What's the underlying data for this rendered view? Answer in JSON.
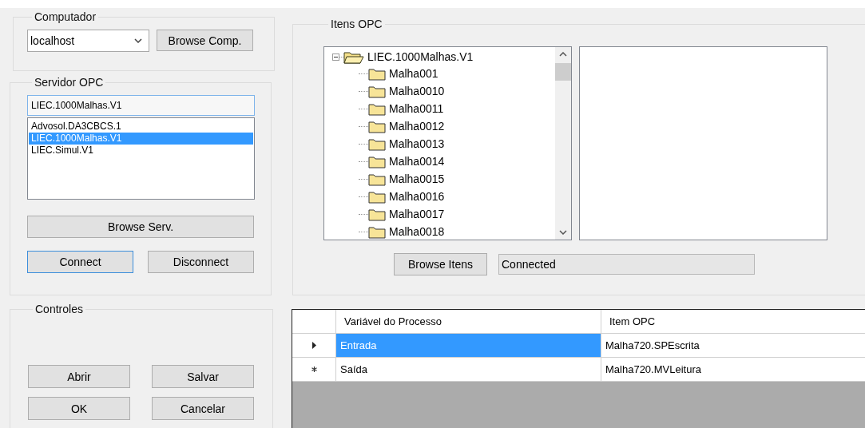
{
  "computer": {
    "title": "Computador",
    "value": "localhost",
    "browse_button": "Browse Comp."
  },
  "server": {
    "title": "Servidor OPC",
    "value": "LIEC.1000Malhas.V1",
    "list": [
      {
        "label": "Advosol.DA3CBCS.1",
        "selected": false
      },
      {
        "label": "LIEC.1000Malhas.V1",
        "selected": true
      },
      {
        "label": "LIEC.Simul.V1",
        "selected": false
      }
    ],
    "browse_button": "Browse Serv.",
    "connect_button": "Connect",
    "disconnect_button": "Disconnect"
  },
  "items": {
    "title": "Itens OPC",
    "tree": {
      "label": "LIEC.1000Malhas.V1",
      "expanded": true,
      "children": [
        {
          "label": "Malha001"
        },
        {
          "label": "Malha0010"
        },
        {
          "label": "Malha0011"
        },
        {
          "label": "Malha0012"
        },
        {
          "label": "Malha0013"
        },
        {
          "label": "Malha0014"
        },
        {
          "label": "Malha0015"
        },
        {
          "label": "Malha0016"
        },
        {
          "label": "Malha0017"
        },
        {
          "label": "Malha0018"
        }
      ]
    },
    "browse_button": "Browse Itens",
    "status": "Connected"
  },
  "controls": {
    "title": "Controles",
    "buttons": [
      "Abrir",
      "Salvar",
      "OK",
      "Cancelar"
    ]
  },
  "grid": {
    "columns": [
      "Variável do Processo",
      "Item OPC"
    ],
    "rows": [
      {
        "kind": "current",
        "cells": [
          {
            "text": "Entrada",
            "selected": true
          },
          {
            "text": "Malha720.SPEscrita",
            "selected": false
          }
        ]
      },
      {
        "kind": "new",
        "cells": [
          {
            "text": "Saída",
            "selected": false
          },
          {
            "text": "Malha720.MVLeitura",
            "selected": false
          }
        ]
      }
    ]
  }
}
